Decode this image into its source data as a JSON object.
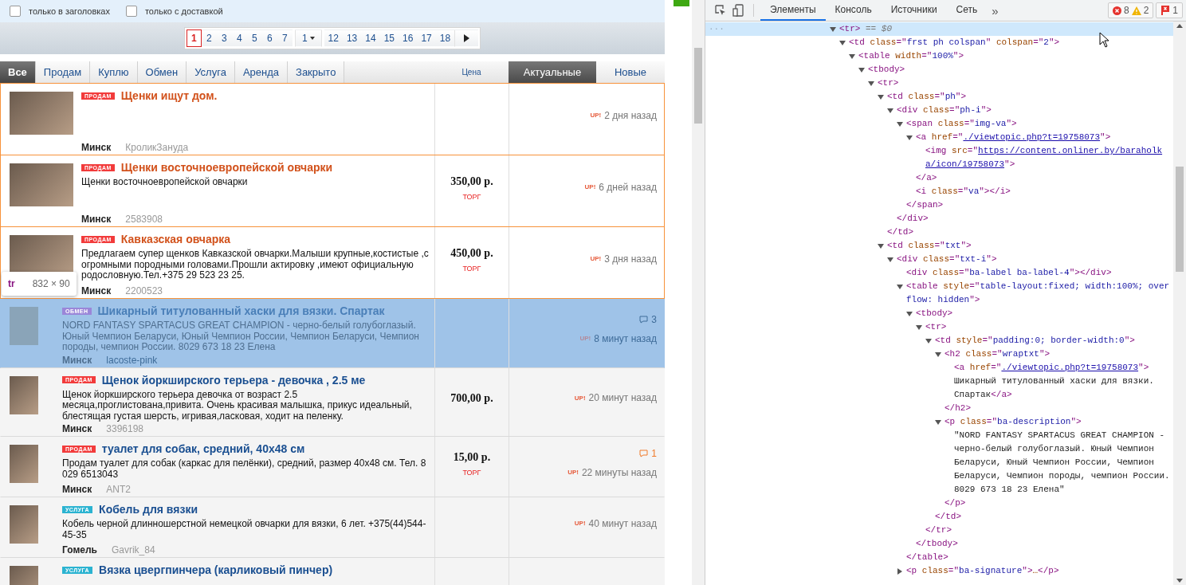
{
  "filters": [
    {
      "label": "только в заголовках",
      "checked": false
    },
    {
      "label": "только с доставкой",
      "checked": false
    }
  ],
  "pager": [
    {
      "kind": "page",
      "label": "1",
      "selected": true
    },
    {
      "kind": "page",
      "label": "2",
      "selected": false
    },
    {
      "kind": "page",
      "label": "3",
      "selected": false
    },
    {
      "kind": "page",
      "label": "4",
      "selected": false
    },
    {
      "kind": "page",
      "label": "5",
      "selected": false
    },
    {
      "kind": "page",
      "label": "6",
      "selected": false
    },
    {
      "kind": "page",
      "label": "7",
      "selected": false
    },
    {
      "kind": "dropdown",
      "label": "1",
      "selected": false
    },
    {
      "kind": "page",
      "label": "12",
      "selected": false
    },
    {
      "kind": "page",
      "label": "13",
      "selected": false
    },
    {
      "kind": "page",
      "label": "14",
      "selected": false
    },
    {
      "kind": "page",
      "label": "15",
      "selected": false
    },
    {
      "kind": "page",
      "label": "16",
      "selected": false
    },
    {
      "kind": "page",
      "label": "17",
      "selected": false
    },
    {
      "kind": "page",
      "label": "18",
      "selected": false
    },
    {
      "kind": "next",
      "selected": false
    }
  ],
  "category_tabs": [
    {
      "label": "Все",
      "selected": true
    },
    {
      "label": "Продам",
      "selected": false
    },
    {
      "label": "Куплю",
      "selected": false
    },
    {
      "label": "Обмен",
      "selected": false
    },
    {
      "label": "Услуга",
      "selected": false
    },
    {
      "label": "Аренда",
      "selected": false
    },
    {
      "label": "Закрыто",
      "selected": false
    }
  ],
  "price_header": "Цена",
  "sort_tabs": [
    {
      "label": "Актуальные",
      "selected": true
    },
    {
      "label": "Новые",
      "selected": false
    }
  ],
  "listings": [
    {
      "premium": true,
      "selected": false,
      "label": "ПРОДАМ",
      "color": "#f23b3b",
      "title": "Щенки ищут дом.",
      "city": "Минск",
      "user": "КроликЗануда",
      "up": "UP!",
      "time": "2 дня назад"
    },
    {
      "premium": true,
      "selected": false,
      "label": "ПРОДАМ",
      "color": "#f23b3b",
      "title": "Щенки восточноевропейской овчарки",
      "description": "Щенки восточноевропейской овчарки",
      "city": "Минск",
      "user": "2583908",
      "price": "350,00 р.",
      "bargain": "ТОРГ",
      "up": "UP!",
      "time": "6 дней назад"
    },
    {
      "premium": true,
      "selected": false,
      "label": "ПРОДАМ",
      "color": "#f23b3b",
      "title": "Кавказская овчарка",
      "description": "Предлагаем супер щенков Кавказской овчарки.Малыши крупные,костистые ,с огромными породными головами.Прошли актировку ,имеют официальную родословную.Тел.+375 29 523 23 25.",
      "city": "Минск",
      "user": "2200523",
      "price": "450,00 р.",
      "bargain": "ТОРГ",
      "up": "UP!",
      "time": "3 дня назад"
    },
    {
      "premium": false,
      "selected": true,
      "label": "ОБМЕН",
      "color": "#9a86d8",
      "title": "Шикарный титулованный хаски для вязки. Спартак",
      "description": "NORD FANTASY SPARTACUS GREAT CHAMPION - черно-белый голубоглазый. Юный Чемпион Беларуси, Юный Чемпион России, Чемпион Беларуси, Чемпион породы, чемпион России. 8029 673 18 23 Елена",
      "city": "Минск",
      "user": "lacoste-pink",
      "comments": "3",
      "up": "UP!",
      "time": "8 минут назад"
    },
    {
      "premium": false,
      "selected": false,
      "label": "ПРОДАМ",
      "color": "#f23b3b",
      "title": "Щенок йоркширского терьера -  девочка , 2.5 ме",
      "description": "Щенок йоркширского терьера девочка от возраст 2.5 месяца,проглистована,привита. Очень красивая малышка, прикус идеальный, блестящая густая шерсть, игривая,ласковая, ходит на пеленку.",
      "city": "Минск",
      "user": "3396198",
      "price": "700,00 р.",
      "up": "UP!",
      "time": "20 минут назад"
    },
    {
      "premium": false,
      "selected": false,
      "label": "ПРОДАМ",
      "color": "#f23b3b",
      "title": "туалет для собак, средний, 40x48 см",
      "description": "Продам туалет для собак (каркас для пелёнки), средний, размер 40x48 см. Тел. 8 029 6513043",
      "city": "Минск",
      "user": "ANT2",
      "price": "15,00 р.",
      "bargain": "ТОРГ",
      "comments": "1",
      "up": "UP!",
      "time": "22 минуты назад"
    },
    {
      "premium": false,
      "selected": false,
      "label": "УСЛУГА",
      "color": "#2bb3d1",
      "title": "Кобель для вязки",
      "description": "Кобель черной длинношерстной немецкой овчарки для вязки, 6 лет. +375(44)544-45-35",
      "city": "Гомель",
      "user": "Gavrik_84",
      "up": "UP!",
      "time": "40 минут назад"
    },
    {
      "premium": false,
      "selected": false,
      "label": "УСЛУГА",
      "color": "#2bb3d1",
      "title": "Вязка цвергпинчера (карликовый пинчер)"
    }
  ],
  "inspect_tooltip": {
    "tag": "tr",
    "size": "832 × 90"
  },
  "devtools": {
    "tabs": [
      {
        "label": "Элементы",
        "selected": true
      },
      {
        "label": "Консоль",
        "selected": false
      },
      {
        "label": "Источники",
        "selected": false
      },
      {
        "label": "Сеть",
        "selected": false
      }
    ],
    "more": "»",
    "dots": "···",
    "errors": "8",
    "warnings": "2",
    "issues": "1",
    "tree": [
      {
        "kind": "element",
        "text": "<tr>",
        "marker": "== $0",
        "selected": true,
        "expanded": true,
        "children": [
          {
            "kind": "element",
            "text": "<td class=\"frst ph colspan\" colspan=\"2\">",
            "expanded": true,
            "children": [
              {
                "kind": "element",
                "text": "<table width=\"100%\">",
                "expanded": true,
                "children": [
                  {
                    "kind": "element",
                    "text": "<tbody>",
                    "expanded": true,
                    "children": [
                      {
                        "kind": "element",
                        "text": "<tr>",
                        "expanded": true,
                        "children": [
                          {
                            "kind": "element",
                            "text": "<td class=\"ph\">",
                            "expanded": true,
                            "close": "</td>",
                            "children": [
                              {
                                "kind": "element",
                                "text": "<div class=\"ph-i\">",
                                "expanded": true,
                                "close": "</div>",
                                "children": [
                                  {
                                    "kind": "element",
                                    "text": "<span class=\"img-va\">",
                                    "expanded": true,
                                    "close": "</span>",
                                    "children": [
                                      {
                                        "kind": "element",
                                        "text": "<a href=\"./viewtopic.php?t=19758073\">",
                                        "link": true,
                                        "expanded": true,
                                        "close": "</a>",
                                        "children": [
                                          {
                                            "kind": "element",
                                            "text": "<img src=\"https://content.onliner.by/baraholka/icon/19758073\">",
                                            "link": true
                                          }
                                        ]
                                      },
                                      {
                                        "kind": "element",
                                        "text": "<i class=\"va\"></i>"
                                      }
                                    ]
                                  }
                                ]
                              }
                            ]
                          },
                          {
                            "kind": "element",
                            "text": "<td class=\"txt\">",
                            "expanded": true,
                            "children": [
                              {
                                "kind": "element",
                                "text": "<div class=\"txt-i\">",
                                "expanded": true,
                                "children": [
                                  {
                                    "kind": "element",
                                    "text": "<div class=\"ba-label ba-label-4\"></div>"
                                  },
                                  {
                                    "kind": "element",
                                    "text": "<table style=\"table-layout:fixed; width:100%; overflow: hidden\">",
                                    "expanded": true,
                                    "close": "</table>",
                                    "children": [
                                      {
                                        "kind": "element",
                                        "text": "<tbody>",
                                        "expanded": true,
                                        "close": "</tbody>",
                                        "children": [
                                          {
                                            "kind": "element",
                                            "text": "<tr>",
                                            "expanded": true,
                                            "close": "</tr>",
                                            "children": [
                                              {
                                                "kind": "element",
                                                "text": "<td style=\"padding:0; border-width:0\">",
                                                "expanded": true,
                                                "close": "</td>",
                                                "children": [
                                                  {
                                                    "kind": "element",
                                                    "text": "<h2 class=\"wraptxt\">",
                                                    "expanded": true,
                                                    "close": "</h2>",
                                                    "children": [
                                                      {
                                                        "kind": "element",
                                                        "text": "<a href=\"./viewtopic.php?t=19758073\">",
                                                        "link": true
                                                      },
                                                      {
                                                        "kind": "text",
                                                        "text": "Шикарный титулованный хаски для вязки. Спартак",
                                                        "close": "</a>"
                                                      }
                                                    ]
                                                  },
                                                  {
                                                    "kind": "element",
                                                    "text": "<p class=\"ba-description\">",
                                                    "expanded": true,
                                                    "close": "</p>",
                                                    "children": [
                                                      {
                                                        "kind": "text",
                                                        "text": "\"NORD FANTASY SPARTACUS GREAT CHAMPION - черно-белый голубоглазый. Юный Чемпион Беларуси, Юный Чемпион России, Чемпион Беларуси, Чемпион породы, чемпион России. 8029 673 18 23 Елена\""
                                                      }
                                                    ]
                                                  }
                                                ]
                                              }
                                            ]
                                          }
                                        ]
                                      }
                                    ]
                                  },
                                  {
                                    "kind": "element",
                                    "text": "<p class=\"ba-signature\">…</p>",
                                    "expanded": false
                                  }
                                ]
                              }
                            ]
                          }
                        ]
                      }
                    ]
                  }
                ]
              }
            ]
          }
        ]
      }
    ]
  }
}
